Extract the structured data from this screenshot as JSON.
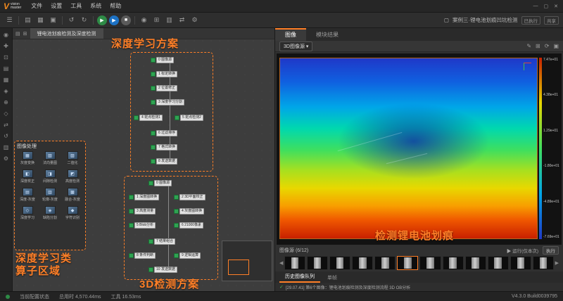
{
  "colors": {
    "accent": "#ff7f27",
    "node_green": "#2fa352"
  },
  "titlebar": {
    "logo": {
      "v": "V",
      "line1": "vision",
      "line2": "master"
    },
    "menus": [
      "文件",
      "设置",
      "工具",
      "系统",
      "帮助"
    ],
    "window_controls": {
      "minimize": "—",
      "maximize": "▢",
      "close": "✕"
    }
  },
  "toolbar": {
    "icons": [
      {
        "name": "menu-icon",
        "glyph": "☰"
      },
      {
        "name": "new-solution-icon",
        "glyph": "▤"
      },
      {
        "name": "open-solution-icon",
        "glyph": "▦"
      },
      {
        "name": "save-solution-icon",
        "glyph": "▣"
      },
      {
        "name": "undo-icon",
        "glyph": "↺"
      },
      {
        "name": "redo-icon",
        "glyph": "↻"
      },
      {
        "name": "camera-icon",
        "glyph": "◉"
      },
      {
        "name": "grid-view-icon",
        "glyph": "⊞"
      },
      {
        "name": "layout-icon",
        "glyph": "▥"
      },
      {
        "name": "compare-icon",
        "glyph": "⇄"
      },
      {
        "name": "settings-icon",
        "glyph": "⚙"
      }
    ],
    "run_all_glyph": "▶",
    "run_once_glyph": "▶",
    "stop_glyph": "■",
    "monitor_glyph": "▢",
    "solution_name": "案例三·锂电池划痕凹坑检测",
    "badge_executed": "已执行",
    "badge_share": "共享"
  },
  "sidebar": {
    "icons": [
      {
        "name": "zoom-icon",
        "glyph": "◉"
      },
      {
        "name": "pan-icon",
        "glyph": "✚"
      },
      {
        "name": "fit-view-icon",
        "glyph": "⊡"
      },
      {
        "name": "module-list-icon",
        "glyph": "▤"
      },
      {
        "name": "image-process-icon",
        "glyph": "▦"
      },
      {
        "name": "measure-icon",
        "glyph": "◈"
      },
      {
        "name": "calibration-icon",
        "glyph": "⊕"
      },
      {
        "name": "deep-learning-icon",
        "glyph": "◇"
      },
      {
        "name": "communication-icon",
        "glyph": "⇄"
      },
      {
        "name": "history-icon",
        "glyph": "↺"
      },
      {
        "name": "layers-icon",
        "glyph": "▥"
      },
      {
        "name": "settings-icon",
        "glyph": "⚙"
      }
    ]
  },
  "canvas": {
    "tab_title": "锂电池划痕检测及深度检测",
    "tab_icon1": "▤",
    "tab_icon2": "⊞",
    "annotations": {
      "deep_learning": "深度学习方案",
      "operator_area_line1": "深度学习类",
      "operator_area_line2": "算子区域",
      "flow_3d": "3D检测方案",
      "image_note": "检测锂电池划痕"
    },
    "algo_panel": {
      "title": "图像处理",
      "items": [
        "灰度变换",
        "法向量图",
        "二值化",
        "深度校正",
        "间隙检测",
        "高度检测",
        "深度-灰度",
        "轮廓-灰度",
        "融合-灰度",
        "深度学习",
        "缺陷分割",
        "字符识别"
      ]
    },
    "flow1": {
      "nodes": [
        "0 图像源",
        "1 标定转换",
        "2 位置修正",
        "3 深度学习分割",
        "4 斑点检测1",
        "5 斑点检测2",
        "6 过滤排序",
        "7 格式转换",
        "8 发送数据"
      ]
    },
    "flow2": {
      "nodes": [
        "0 图像源",
        "1 深度图转换",
        "2 3D平面校正",
        "3 高度测量",
        "4 灰度图转换",
        "5 Blob分析",
        "6 21000像素",
        "7 结果组合",
        "8 条件判断",
        "9 逻辑运算",
        "10 发送数据"
      ]
    }
  },
  "right_panel": {
    "tabs": [
      "图像",
      "模块结果"
    ],
    "source_select": "3D图像源",
    "source_caret": "▾",
    "view_icons": [
      {
        "name": "edit-icon",
        "glyph": "✎"
      },
      {
        "name": "fit-image-icon",
        "glyph": "⊞"
      },
      {
        "name": "refresh-icon",
        "glyph": "⟳"
      },
      {
        "name": "fullscreen-icon",
        "glyph": "▣"
      }
    ],
    "colorbar": [
      "7.47e+01",
      "4.38e+01",
      "1.29e+01",
      "-1.80e+01",
      "-4.89e+01",
      "-7.69e+01"
    ],
    "film_label": "图像源 (6/12)",
    "run_once_label": "▶ 运行(仅本次)",
    "exec_label": "执行",
    "prev_glyph": "◀",
    "next_glyph": "▶",
    "history_tabs": [
      "历史图像队列",
      "单帧"
    ],
    "status_check": "✓",
    "status_message": "[29.07.41] 第6个图像：锂电池划痕检测及深度检测流程 3D OB分析"
  },
  "statusbar": {
    "left": "当前配置状态",
    "total_time": "总用时 4,570.44ms",
    "tool_time": "工具 16.53ms",
    "version": "V4.3.0 Build0039795"
  }
}
